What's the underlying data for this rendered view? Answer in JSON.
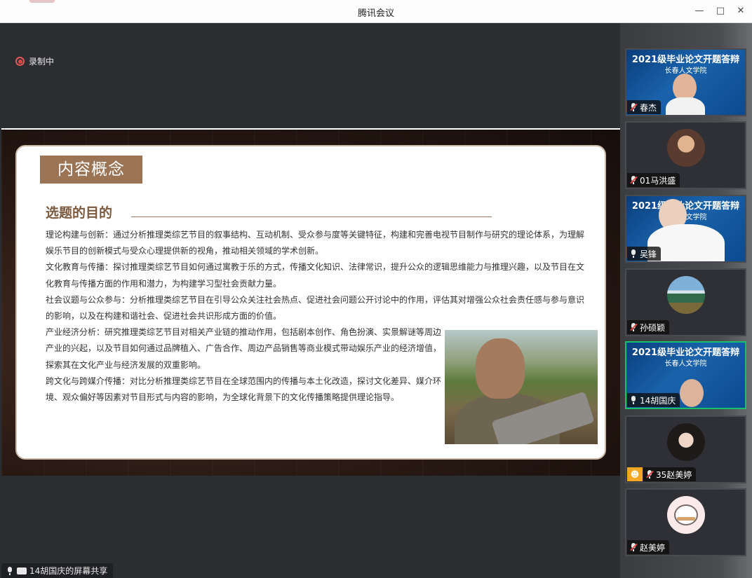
{
  "window": {
    "title": "腾讯会议"
  },
  "recording": {
    "label": "录制中"
  },
  "slide": {
    "tag": "内容概念",
    "subheading": "选题的目的",
    "paragraphs": [
      "理论构建与创新：通过分析推理类综艺节目的叙事结构、互动机制、受众参与度等关键特征，构建和完善电视节目制作与研究的理论体系，为理解娱乐节目的创新模式与受众心理提供新的视角，推动相关领域的学术创新。",
      "文化教育与传播：探讨推理类综艺节目如何通过寓教于乐的方式，传播文化知识、法律常识，提升公众的逻辑思维能力与推理兴趣，以及节目在文化教育与传播方面的作用和潜力，为构建学习型社会贡献力量。",
      "社会议题与公众参与：分析推理类综艺节目在引导公众关注社会热点、促进社会问题公开讨论中的作用，评估其对增强公众社会责任感与参与意识的影响，以及在构建和谐社会、促进社会共识形成方面的价值。",
      "产业经济分析：研究推理类综艺节目对相关产业链的推动作用，包括剧本创作、角色扮演、实景解谜等周边产业的兴起，以及节目如何通过品牌植入、广告合作、周边产品销售等商业模式带动娱乐产业的经济增值，探索其在文化产业与经济发展的双重影响。",
      "跨文化与跨媒介传播：对比分析推理类综艺节目在全球范围内的传播与本土化改造，探讨文化差异、媒介环境、观众偏好等因素对节目形式与内容的影响，为全球化背景下的文化传播策略提供理论指导。"
    ]
  },
  "share_status": "14胡国庆的屏幕共享",
  "banner": {
    "title": "2021级毕业论文开题答辩",
    "subtitle": "长春人文学院"
  },
  "participants": [
    {
      "name": "春杰",
      "muted": true,
      "video": true
    },
    {
      "name": "01马洪盛",
      "muted": true,
      "video": false
    },
    {
      "name": "吴锋",
      "muted": false,
      "video": true
    },
    {
      "name": "孙硕颖",
      "muted": true,
      "video": false
    },
    {
      "name": "14胡国庆",
      "muted": false,
      "video": true,
      "active": true
    },
    {
      "name": "35赵美婷",
      "muted": true,
      "video": false
    },
    {
      "name": "赵美婷",
      "muted": true,
      "video": false
    }
  ],
  "colors": {
    "accent_green": "#16c16b",
    "tag_brown": "#9a7455",
    "rec_red": "#e24646"
  },
  "icons": [
    "record-icon",
    "mic-icon",
    "mic-muted-icon",
    "screen-share-icon",
    "minimize-icon",
    "maximize-icon",
    "close-icon",
    "person-icon"
  ]
}
